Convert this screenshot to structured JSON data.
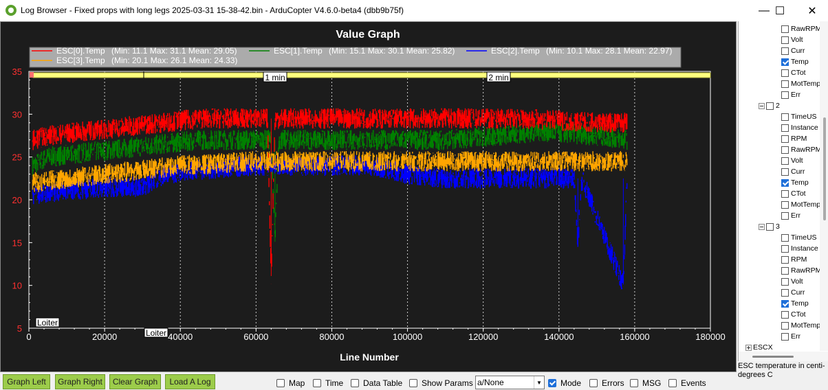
{
  "window": {
    "title": "Log Browser - Fixed props with long legs 2025-03-31 15-38-42.bin - ArduCopter V4.6.0-beta4 (dbb9b75f)",
    "minimize": "—",
    "maximize": "☐",
    "close": "✕"
  },
  "graph": {
    "title": "Value Graph",
    "xlabel": "Line Number",
    "time_markers": [
      "1 min",
      "2 min"
    ],
    "mode_labels": [
      "Loiter",
      "Loiter"
    ]
  },
  "chart_data": {
    "type": "line",
    "title": "Value Graph",
    "xlabel": "Line Number",
    "ylabel": "",
    "xlim": [
      0,
      180000
    ],
    "ylim": [
      5,
      35
    ],
    "xticks": [
      0,
      20000,
      40000,
      60000,
      80000,
      100000,
      120000,
      140000,
      160000,
      180000
    ],
    "yticks": [
      5,
      10,
      15,
      20,
      25,
      30,
      35
    ],
    "legend_position": "top",
    "series": [
      {
        "name": "ESC[0].Temp",
        "stats": "(Min: 11.1 Max: 31.1 Mean: 29.05)",
        "color": "#ff0000",
        "min": 11.1,
        "max": 31.1,
        "mean": 29.05,
        "x": [
          1000,
          5000,
          15000,
          25000,
          35000,
          45000,
          60000,
          63000,
          64000,
          65000,
          70000,
          90000,
          110000,
          130000,
          150000,
          158000
        ],
        "y": [
          27,
          27.5,
          28,
          28.5,
          29,
          29.5,
          29.5,
          29.5,
          11.1,
          29.5,
          29.5,
          29.5,
          29.5,
          29.5,
          29,
          29
        ]
      },
      {
        "name": "ESC[1].Temp",
        "stats": "(Min: 15.1 Max: 30.1 Mean: 25.82)",
        "color": "#008000",
        "min": 15.1,
        "max": 30.1,
        "mean": 25.82,
        "x": [
          1000,
          5000,
          15000,
          25000,
          35000,
          45000,
          60000,
          64000,
          65000,
          66000,
          90000,
          110000,
          125000,
          135000,
          150000,
          158000
        ],
        "y": [
          24,
          25,
          25.5,
          26,
          26.5,
          27,
          27,
          27,
          15.1,
          27,
          27,
          27,
          27.5,
          28,
          27.5,
          27
        ]
      },
      {
        "name": "ESC[2].Temp",
        "stats": "(Min: 10.1 Max: 28.1 Mean: 22.97)",
        "color": "#0000ff",
        "min": 10.1,
        "max": 28.1,
        "mean": 22.97,
        "x": [
          1000,
          10000,
          20000,
          30000,
          36000,
          45000,
          60000,
          90000,
          100000,
          110000,
          130000,
          144000,
          145000,
          146000,
          157000,
          158000
        ],
        "y": [
          20.5,
          21,
          21.5,
          21.5,
          23,
          23.5,
          24,
          24,
          23,
          22.5,
          22.5,
          22.5,
          15,
          22.5,
          10.1,
          22.5
        ]
      },
      {
        "name": "ESC[3].Temp",
        "stats": "(Min: 20.1 Max: 26.1 Mean: 24.33)",
        "color": "#ffa500",
        "min": 20.1,
        "max": 26.1,
        "mean": 24.33,
        "x": [
          1000,
          10000,
          20000,
          30000,
          40000,
          60000,
          90000,
          110000,
          130000,
          150000,
          158000
        ],
        "y": [
          22,
          22.5,
          23,
          23.5,
          24,
          24.5,
          24.5,
          24.5,
          24.5,
          24.5,
          24.5
        ]
      }
    ]
  },
  "tree": {
    "items": [
      {
        "type": "leaf",
        "label": "RawRPM",
        "checked": false
      },
      {
        "type": "leaf",
        "label": "Volt",
        "checked": false
      },
      {
        "type": "leaf",
        "label": "Curr",
        "checked": false
      },
      {
        "type": "leaf",
        "label": "Temp",
        "checked": true
      },
      {
        "type": "leaf",
        "label": "CTot",
        "checked": false
      },
      {
        "type": "leaf",
        "label": "MotTemp",
        "checked": false
      },
      {
        "type": "leaf",
        "label": "Err",
        "checked": false
      },
      {
        "type": "group",
        "label": "2",
        "checked": false
      },
      {
        "type": "leaf",
        "label": "TimeUS",
        "checked": false
      },
      {
        "type": "leaf",
        "label": "Instance",
        "checked": false
      },
      {
        "type": "leaf",
        "label": "RPM",
        "checked": false
      },
      {
        "type": "leaf",
        "label": "RawRPM",
        "checked": false
      },
      {
        "type": "leaf",
        "label": "Volt",
        "checked": false
      },
      {
        "type": "leaf",
        "label": "Curr",
        "checked": false
      },
      {
        "type": "leaf",
        "label": "Temp",
        "checked": true
      },
      {
        "type": "leaf",
        "label": "CTot",
        "checked": false
      },
      {
        "type": "leaf",
        "label": "MotTemp",
        "checked": false
      },
      {
        "type": "leaf",
        "label": "Err",
        "checked": false
      },
      {
        "type": "group",
        "label": "3",
        "checked": false
      },
      {
        "type": "leaf",
        "label": "TimeUS",
        "checked": false
      },
      {
        "type": "leaf",
        "label": "Instance",
        "checked": false
      },
      {
        "type": "leaf",
        "label": "RPM",
        "checked": false
      },
      {
        "type": "leaf",
        "label": "RawRPM",
        "checked": false
      },
      {
        "type": "leaf",
        "label": "Volt",
        "checked": false
      },
      {
        "type": "leaf",
        "label": "Curr",
        "checked": false
      },
      {
        "type": "leaf",
        "label": "Temp",
        "checked": true
      },
      {
        "type": "leaf",
        "label": "CTot",
        "checked": false
      },
      {
        "type": "leaf",
        "label": "MotTemp",
        "checked": false
      },
      {
        "type": "leaf",
        "label": "Err",
        "checked": false
      },
      {
        "type": "root",
        "label": "ESCX",
        "checked": false
      }
    ],
    "description": "ESC temperature in centi-degrees C"
  },
  "toolbar": {
    "graph_left": "Graph Left",
    "graph_right": "Graph Right",
    "clear_graph": "Clear Graph",
    "load_log": "Load A Log",
    "map": "Map",
    "time": "Time",
    "data_table": "Data Table",
    "show_params": "Show Params",
    "select_value": "a/None",
    "mode": "Mode",
    "errors": "Errors",
    "msg": "MSG",
    "events": "Events"
  },
  "checkbox_states": {
    "map": false,
    "time": false,
    "data_table": false,
    "show_params": false,
    "mode": true,
    "errors": false,
    "msg": false,
    "events": false
  }
}
